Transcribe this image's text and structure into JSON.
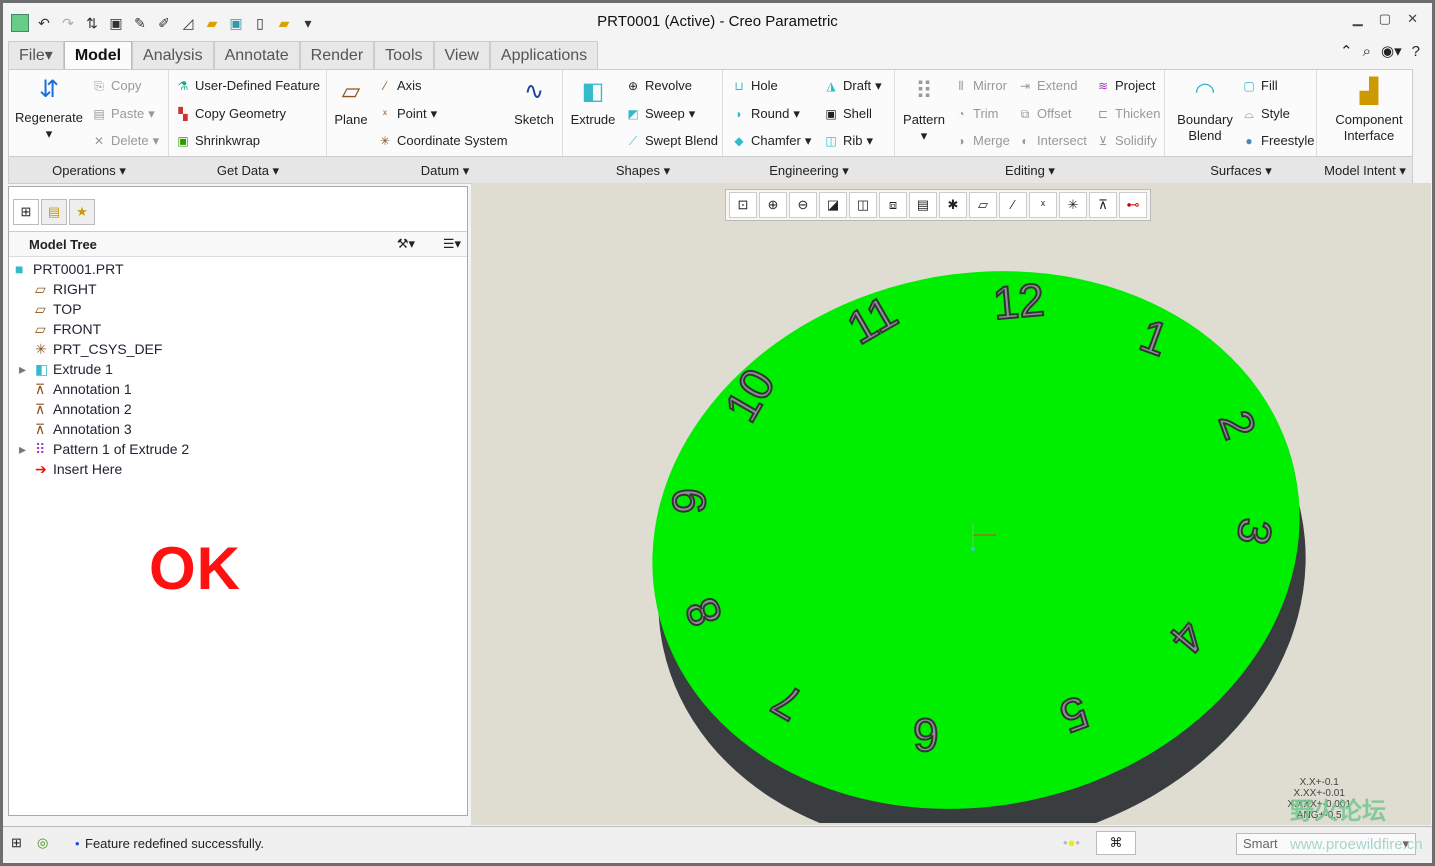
{
  "window": {
    "title": "PRT0001 (Active) - Creo Parametric"
  },
  "tabs": [
    {
      "label": "File"
    },
    {
      "label": "Model"
    },
    {
      "label": "Analysis"
    },
    {
      "label": "Annotate"
    },
    {
      "label": "Render"
    },
    {
      "label": "Tools"
    },
    {
      "label": "View"
    },
    {
      "label": "Applications"
    }
  ],
  "ribbon": {
    "operations": {
      "regenerate": "Regenerate",
      "copy": "Copy",
      "paste": "Paste",
      "delete": "Delete"
    },
    "get_data": {
      "udf": "User-Defined Feature",
      "copy_geometry": "Copy Geometry",
      "shrinkwrap": "Shrinkwrap"
    },
    "datum": {
      "plane": "Plane",
      "axis": "Axis",
      "point": "Point",
      "csys": "Coordinate System",
      "sketch": "Sketch"
    },
    "shapes": {
      "extrude": "Extrude",
      "revolve": "Revolve",
      "sweep": "Sweep",
      "swept_blend": "Swept Blend"
    },
    "engineering": {
      "hole": "Hole",
      "round": "Round",
      "chamfer": "Chamfer",
      "draft": "Draft",
      "shell": "Shell",
      "rib": "Rib"
    },
    "editing": {
      "pattern": "Pattern",
      "mirror": "Mirror",
      "trim": "Trim",
      "merge": "Merge",
      "extend": "Extend",
      "offset": "Offset",
      "intersect": "Intersect",
      "project": "Project",
      "thicken": "Thicken",
      "solidify": "Solidify"
    },
    "surfaces": {
      "boundary_blend": "Boundary Blend",
      "fill": "Fill",
      "style": "Style",
      "freestyle": "Freestyle"
    },
    "model_intent": {
      "component_interface": "Component Interface"
    }
  },
  "groups": [
    "Operations",
    "Get Data",
    "Datum",
    "Shapes",
    "Engineering",
    "Editing",
    "Surfaces",
    "Model Intent"
  ],
  "model_tree": {
    "header": "Model Tree",
    "items": [
      {
        "label": "PRT0001.PRT",
        "icon": "part-icon"
      },
      {
        "label": "RIGHT",
        "icon": "datum-plane-icon"
      },
      {
        "label": "TOP",
        "icon": "datum-plane-icon"
      },
      {
        "label": "FRONT",
        "icon": "datum-plane-icon"
      },
      {
        "label": "PRT_CSYS_DEF",
        "icon": "csys-icon"
      },
      {
        "label": "Extrude 1",
        "icon": "extrude-icon",
        "expandable": true
      },
      {
        "label": "Annotation 1",
        "icon": "annotation-icon"
      },
      {
        "label": "Annotation 2",
        "icon": "annotation-icon"
      },
      {
        "label": "Annotation 3",
        "icon": "annotation-icon"
      },
      {
        "label": "Pattern 1 of Extrude 2",
        "icon": "pattern-icon",
        "expandable": true
      },
      {
        "label": "Insert Here",
        "icon": "insert-arrow-icon"
      }
    ]
  },
  "overlay_text": "OK",
  "model": {
    "numerals": [
      "12",
      "1",
      "2",
      "3",
      "4",
      "5",
      "6",
      "7",
      "8",
      "9",
      "10",
      "11"
    ],
    "face_color": "#00ee00",
    "side_color": "#3a3d40"
  },
  "tolerances": [
    "X.X+-0.1",
    "X.XX+-0.01",
    "X.XXX+-0.001",
    "ANG+-0.5"
  ],
  "status": {
    "message": "Feature redefined successfully.",
    "filter": "Smart"
  },
  "watermark": {
    "text": "野火论坛",
    "url": "www.proewildfire.cn"
  }
}
